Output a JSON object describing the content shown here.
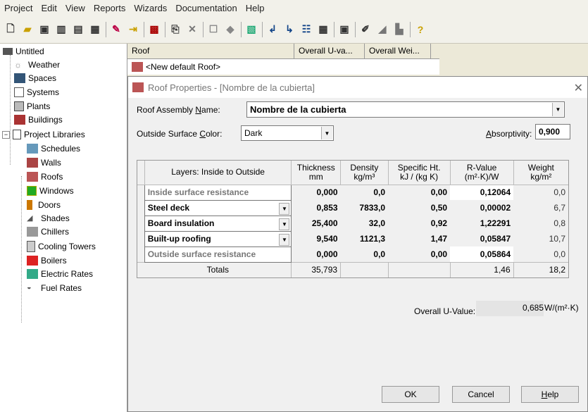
{
  "menu": [
    "Project",
    "Edit",
    "View",
    "Reports",
    "Wizards",
    "Documentation",
    "Help"
  ],
  "tree": {
    "root": "Untitled",
    "items": [
      "Weather",
      "Spaces",
      "Systems",
      "Plants",
      "Buildings",
      "Project Libraries"
    ],
    "libraries": [
      "Schedules",
      "Walls",
      "Roofs",
      "Windows",
      "Doors",
      "Shades",
      "Chillers",
      "Cooling Towers",
      "Boilers",
      "Electric Rates",
      "Fuel Rates"
    ]
  },
  "list": {
    "columns": [
      "Roof",
      "Overall U-va...",
      "Overall Wei..."
    ],
    "row": "<New default Roof>"
  },
  "dialog": {
    "title": "Roof Properties - [Nombre de la cubierta]",
    "name_label_a": "Roof Assembly ",
    "name_label_u": "N",
    "name_label_b": "ame:",
    "name_value": "Nombre de la cubierta",
    "color_label_a": "Outside Surface ",
    "color_label_u": "C",
    "color_label_b": "olor:",
    "color_value": "Dark",
    "abs_label_u": "A",
    "abs_label_b": "bsorptivity:",
    "abs_value": "0,900",
    "headers": {
      "layers": "Layers: Inside to Outside",
      "thickness": "Thickness",
      "thickness_u": "mm",
      "density": "Density",
      "density_u": "kg/m³",
      "specific": "Specific Ht.",
      "specific_u": "kJ / (kg K)",
      "rvalue": "R-Value",
      "rvalue_u": "(m²·K)/W",
      "weight": "Weight",
      "weight_u": "kg/m²"
    },
    "layers": [
      {
        "name": "Inside surface resistance",
        "thickness": "0,000",
        "density": "0,0",
        "specific": "0,00",
        "rvalue": "0,12064",
        "weight": "0,0"
      },
      {
        "name": "Steel deck",
        "thickness": "0,853",
        "density": "7833,0",
        "specific": "0,50",
        "rvalue": "0,00002",
        "weight": "6,7"
      },
      {
        "name": "Board insulation",
        "thickness": "25,400",
        "density": "32,0",
        "specific": "0,92",
        "rvalue": "1,22291",
        "weight": "0,8"
      },
      {
        "name": "Built-up roofing",
        "thickness": "9,540",
        "density": "1121,3",
        "specific": "1,47",
        "rvalue": "0,05847",
        "weight": "10,7"
      },
      {
        "name": "Outside surface resistance",
        "thickness": "0,000",
        "density": "0,0",
        "specific": "0,00",
        "rvalue": "0,05864",
        "weight": "0,0"
      }
    ],
    "totals": {
      "label": "Totals",
      "thickness": "35,793",
      "rvalue": "1,46",
      "weight": "18,2"
    },
    "uvalue_label": "Overall U-Value:",
    "uvalue": "0,685",
    "uvalue_unit": "W/(m²·K)",
    "buttons": {
      "ok": "OK",
      "cancel": "Cancel",
      "help_u": "H",
      "help_b": "elp"
    }
  }
}
